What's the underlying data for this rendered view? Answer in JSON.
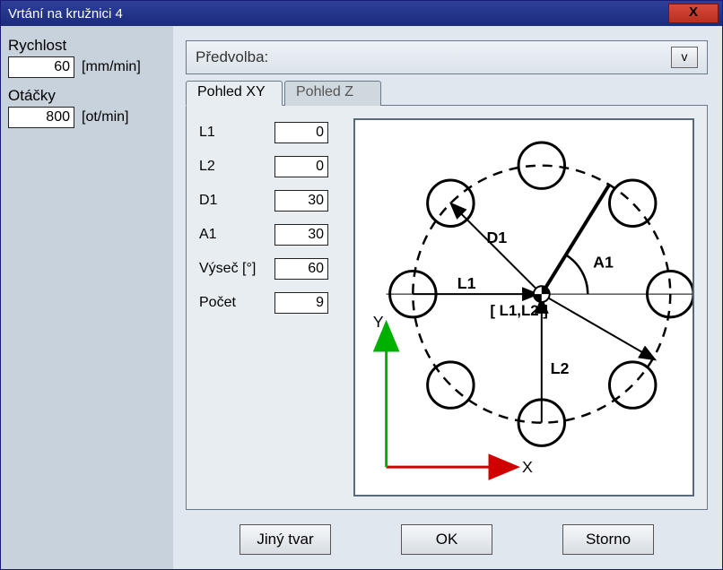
{
  "window": {
    "title": "Vrtání na kružnici 4",
    "close": "X"
  },
  "left": {
    "speed_label": "Rychlost",
    "speed_value": "60",
    "speed_unit": "[mm/min]",
    "rpm_label": "Otáčky",
    "rpm_value": "800",
    "rpm_unit": "[ot/min]"
  },
  "preset": {
    "label": "Předvolba:",
    "v": "v"
  },
  "tabs": {
    "xy": "Pohled XY",
    "z": "Pohled Z"
  },
  "params": {
    "L1": {
      "label": "L1",
      "value": "0"
    },
    "L2": {
      "label": "L2",
      "value": "0"
    },
    "D1": {
      "label": "D1",
      "value": "30"
    },
    "A1": {
      "label": "A1",
      "value": "30"
    },
    "vysec": {
      "label": "Výseč [°]",
      "value": "60"
    },
    "pocet": {
      "label": "Počet",
      "value": "9"
    }
  },
  "diagram": {
    "D1": "D1",
    "L1": "L1",
    "L2": "L2",
    "A1": "A1",
    "center": "[ L1,L2 ]",
    "X": "X",
    "Y": "Y"
  },
  "buttons": {
    "shape": "Jiný tvar",
    "ok": "OK",
    "cancel": "Storno"
  }
}
